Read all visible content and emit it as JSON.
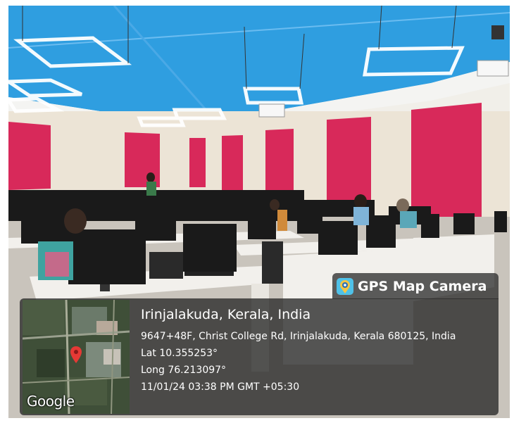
{
  "photo": {
    "subject": "classroom-photo",
    "colors": {
      "ceiling_blue": "#2f9ee0",
      "wall_pink": "#d8295a",
      "wall_cream": "#ece4d6",
      "desk_white": "#f2f0ec",
      "monitor_black": "#1a1a1a"
    }
  },
  "gps_overlay": {
    "app_name": "GPS Map Camera",
    "app_icon": "gps-map-camera-icon",
    "location_title": "Irinjalakuda, Kerala, India",
    "address": "9647+48F, Christ College Rd, Irinjalakuda, Kerala 680125, India",
    "latitude": "Lat 10.355253°",
    "longitude": "Long 76.213097°",
    "datetime": "11/01/24 03:38 PM GMT +05:30",
    "map_attribution": "Google",
    "map_pin_icon": "map-pin-icon"
  }
}
